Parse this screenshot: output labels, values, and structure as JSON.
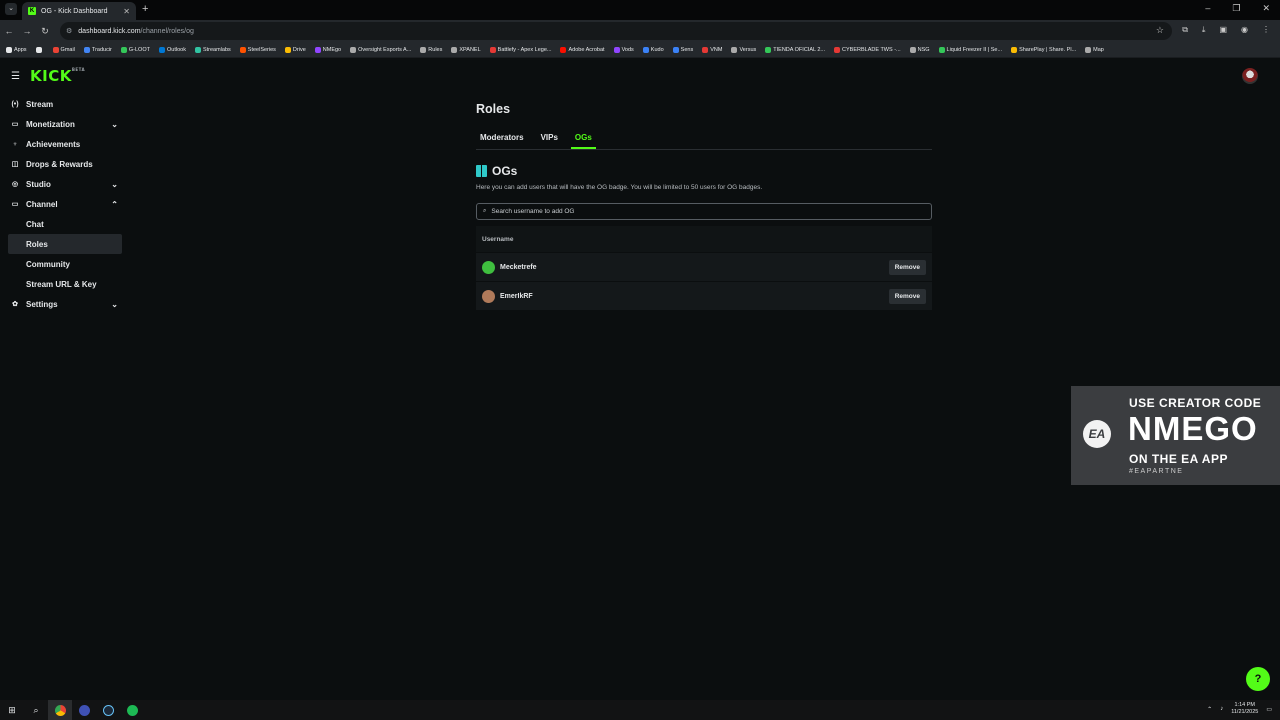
{
  "browser": {
    "tab_title": "OG - Kick Dashboard",
    "url_host": "dashboard.kick.com",
    "url_path": "/channel/roles/og",
    "bookmarks": [
      {
        "label": "Apps",
        "color": "#e6e8ea"
      },
      {
        "label": "",
        "color": "#e6e8ea"
      },
      {
        "label": "Gmail",
        "color": "#ea4335"
      },
      {
        "label": "Traducir",
        "color": "#4285f4"
      },
      {
        "label": "G-LOOT",
        "color": "#34c759"
      },
      {
        "label": "Outlook",
        "color": "#0078d4"
      },
      {
        "label": "Streamlabs",
        "color": "#31c3a2"
      },
      {
        "label": "SteelSeries",
        "color": "#ff5200"
      },
      {
        "label": "Drive",
        "color": "#fbbc04"
      },
      {
        "label": "NMEgo",
        "color": "#9146ff"
      },
      {
        "label": "Oversight Esports A...",
        "color": "#aaaaaa"
      },
      {
        "label": "Rules",
        "color": "#aaaaaa"
      },
      {
        "label": "XPANEL",
        "color": "#aaaaaa"
      },
      {
        "label": "Battlefy - Apex Lege...",
        "color": "#e53935"
      },
      {
        "label": "Adobe Acrobat",
        "color": "#fa0f00"
      },
      {
        "label": "Vods",
        "color": "#9146ff"
      },
      {
        "label": "Kudo",
        "color": "#3b82f6"
      },
      {
        "label": "Sens",
        "color": "#3b82f6"
      },
      {
        "label": "VNM",
        "color": "#e53935"
      },
      {
        "label": "Versus",
        "color": "#aaaaaa"
      },
      {
        "label": "TIENDA OFICIAL 2...",
        "color": "#34c759"
      },
      {
        "label": "CYBERBLADE TWS -...",
        "color": "#e53935"
      },
      {
        "label": "NSG",
        "color": "#aaaaaa"
      },
      {
        "label": "Liquid Freezer II | Se...",
        "color": "#34c759"
      },
      {
        "label": "SharePlay | Share. Pl...",
        "color": "#fbbc04"
      },
      {
        "label": "Map",
        "color": "#aaaaaa"
      }
    ]
  },
  "app": {
    "logo": "KICK",
    "logo_tag": "BETA"
  },
  "sidebar": {
    "items": [
      {
        "label": "Stream",
        "icon": "(•)",
        "chev": ""
      },
      {
        "label": "Monetization",
        "icon": "▭",
        "chev": "⌄"
      },
      {
        "label": "Achievements",
        "icon": "♆",
        "chev": ""
      },
      {
        "label": "Drops & Rewards",
        "icon": "◫",
        "chev": ""
      },
      {
        "label": "Studio",
        "icon": "◎",
        "chev": "⌄"
      },
      {
        "label": "Channel",
        "icon": "▭",
        "chev": "⌃"
      }
    ],
    "channel_sub": [
      "Chat",
      "Roles",
      "Community",
      "Stream URL & Key"
    ],
    "settings": {
      "label": "Settings",
      "icon": "✿",
      "chev": "⌄"
    }
  },
  "main": {
    "title": "Roles",
    "tabs": [
      "Moderators",
      "VIPs",
      "OGs"
    ],
    "section_title": "OGs",
    "description": "Here you can add users that will have the OG badge. You will be limited to 50 users for OG badges.",
    "search_placeholder": "Search username to add OG",
    "table_header": "Username",
    "rows": [
      {
        "username": "Mecketrefe",
        "avatar_color": "#3fbf3f",
        "action": "Remove"
      },
      {
        "username": "EmerIkRF",
        "avatar_color": "#b07a5a",
        "action": "Remove"
      }
    ]
  },
  "overlay": {
    "logo": "EA",
    "line1": "USE CREATOR CODE",
    "line2": "NMEGO",
    "line3": "ON THE EA APP",
    "line4": "#EAPARTNE"
  },
  "taskbar": {
    "time": "1:14 PM",
    "date": "11/21/2025"
  }
}
